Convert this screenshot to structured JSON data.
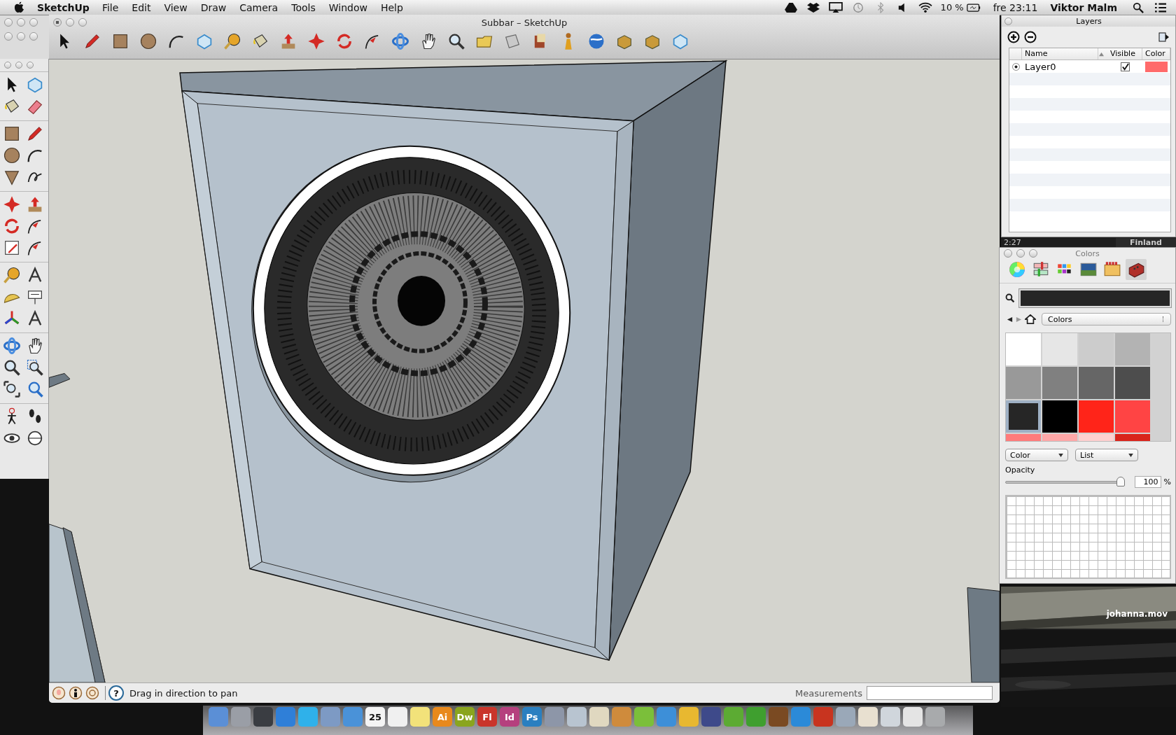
{
  "menu_bar": {
    "app": "SketchUp",
    "items": [
      "File",
      "Edit",
      "View",
      "Draw",
      "Camera",
      "Tools",
      "Window",
      "Help"
    ],
    "battery": "10 %",
    "clock": "fre 23:11",
    "user": "Viktor Malm"
  },
  "window": {
    "title": "Subbar – SketchUp"
  },
  "status_bar": {
    "help_icon": "?",
    "message": "Drag in direction to pan",
    "measurements_label": "Measurements"
  },
  "layers": {
    "title": "Layers",
    "columns": [
      "Name",
      "Visible",
      "Color"
    ],
    "rows": [
      {
        "name": "Layer0",
        "selected": true,
        "visible": true,
        "color": "#ff6a6a"
      }
    ]
  },
  "background_text": {
    "time": "2:27",
    "place": "Finland"
  },
  "colors": {
    "title": "Colors",
    "tabs": [
      {
        "selected": false
      },
      {
        "selected": false
      },
      {
        "selected": false
      },
      {
        "selected": false
      },
      {
        "selected": false
      },
      {
        "selected": true
      }
    ],
    "palette": "Colors",
    "swatches": [
      {
        "color": "#ffffff",
        "selected": false
      },
      {
        "color": "#e6e6e6",
        "selected": false
      },
      {
        "color": "#cccccc",
        "selected": false
      },
      {
        "color": "#b3b3b3",
        "selected": false
      },
      {
        "color": "#999999",
        "selected": false
      },
      {
        "color": "#808080",
        "selected": false
      },
      {
        "color": "#666666",
        "selected": false
      },
      {
        "color": "#4d4d4d",
        "selected": false
      },
      {
        "color": "#262626",
        "selected": true
      },
      {
        "color": "#000000",
        "selected": false
      },
      {
        "color": "#ff2419",
        "selected": false
      },
      {
        "color": "#ff4444",
        "selected": false
      },
      {
        "color": "#ff7b7b",
        "selected": false
      },
      {
        "color": "#ffa8a8",
        "selected": false
      },
      {
        "color": "#ffd0d0",
        "selected": false
      },
      {
        "color": "#d9241b",
        "selected": false
      }
    ],
    "mode": "Color",
    "view": "List",
    "opacity_label": "Opacity",
    "opacity": {
      "level": 1
    },
    "opacity_value": "100",
    "percent": "%"
  },
  "video": {
    "kind": "picture",
    "title": "johanna.mov"
  },
  "dock": [
    {
      "color": "#5b8fd6"
    },
    {
      "color": "#9a9ea6"
    },
    {
      "color": "#3a3d42"
    },
    {
      "color": "#2f7fd8"
    },
    {
      "color": "#2fb1ea"
    },
    {
      "color": "#7d9ac4"
    },
    {
      "color": "#4a92d8"
    },
    {
      "label": "25",
      "color": "#f4f4f4"
    },
    {
      "color": "#f0f0f0"
    },
    {
      "color": "#f2e27a"
    },
    {
      "label": "Ai",
      "color": "#e8891c"
    },
    {
      "label": "Dw",
      "color": "#8aa51e"
    },
    {
      "label": "Fl",
      "color": "#c9352a"
    },
    {
      "label": "Id",
      "color": "#b5407e"
    },
    {
      "label": "Ps",
      "color": "#2a7fc0"
    },
    {
      "color": "#8d96a8"
    },
    {
      "color": "#b8c4d0"
    },
    {
      "color": "#e0d8c0"
    },
    {
      "color": "#cf8b3c"
    },
    {
      "color": "#7bbf3a"
    },
    {
      "color": "#3d8fd8"
    },
    {
      "color": "#e8b830"
    },
    {
      "color": "#3e4a8a"
    },
    {
      "color": "#5cab33"
    },
    {
      "color": "#3f9f2f"
    },
    {
      "color": "#7a4a22"
    },
    {
      "color": "#2b8ad8"
    },
    {
      "color": "#c8341f"
    },
    {
      "color": "#9aa8b8"
    },
    {
      "color": "#e8e0d0"
    },
    {
      "color": "#d0d6dc"
    },
    {
      "color": "#e4e4e4"
    },
    {
      "color": "#a8aaac"
    }
  ]
}
